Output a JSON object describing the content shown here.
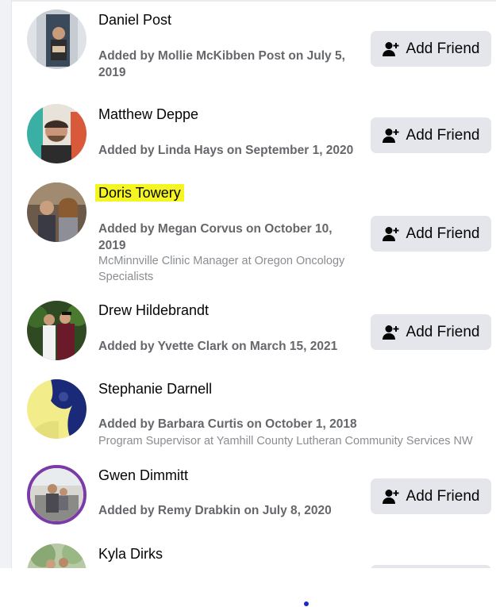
{
  "add_friend_label": "Add Friend",
  "accent_color": "#e4e6eb",
  "highlight_color": "#f5f521",
  "people": [
    {
      "name": "Daniel Post",
      "added": "Added by Mollie McKibben Post on July 5, 2019",
      "detail": ""
    },
    {
      "name": "Matthew Deppe",
      "added": "Added by Linda Hays on September 1, 2020",
      "detail": ""
    },
    {
      "name": "Doris Towery",
      "added": "Added by Megan Corvus on October 10, 2019",
      "detail": "McMinnville Clinic Manager at Oregon Oncology Specialists"
    },
    {
      "name": "Drew Hildebrandt",
      "added": "Added by Yvette Clark on March 15, 2021",
      "detail": ""
    },
    {
      "name": "Stephanie Darnell",
      "added": "Added by Barbara Curtis on October 1, 2018",
      "detail": "Program Supervisor at Yamhill County Lutheran Community Services NW"
    },
    {
      "name": "Gwen Dimmitt",
      "added": "Added by Remy Drabkin on July 8, 2020",
      "detail": ""
    },
    {
      "name": "Kyla Dirks",
      "added": "",
      "detail": ""
    }
  ]
}
